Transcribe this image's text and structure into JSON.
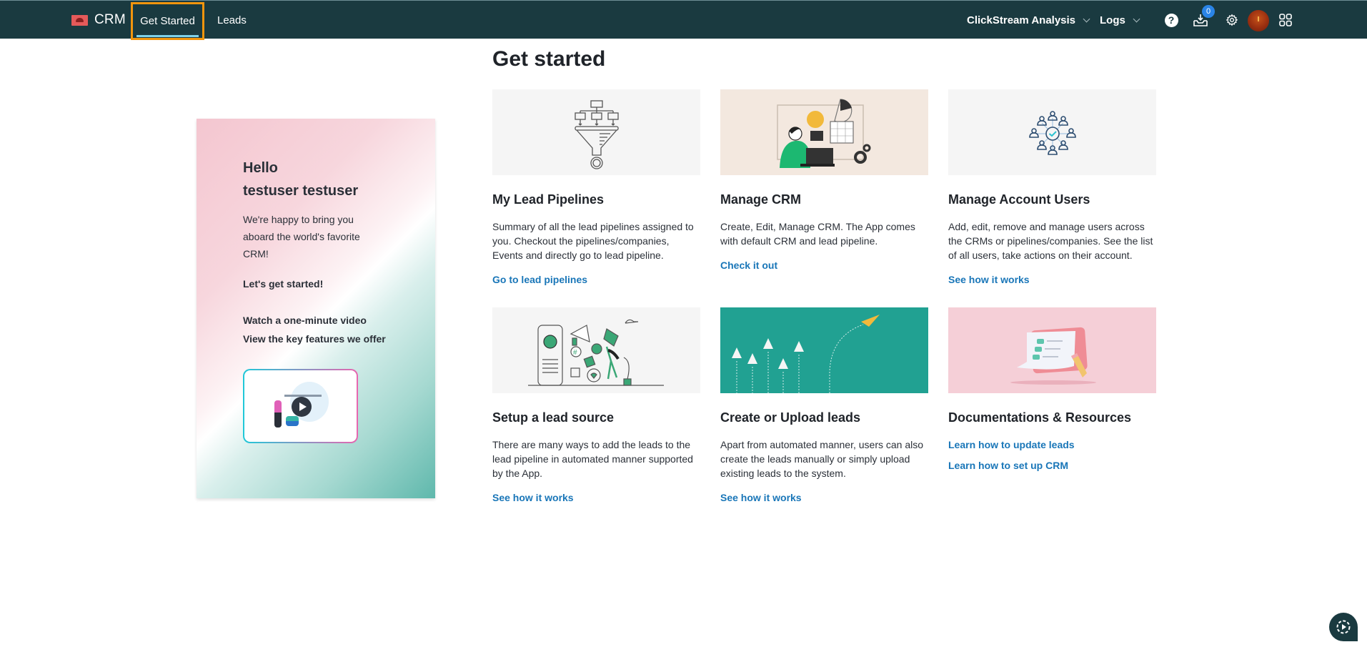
{
  "navbar": {
    "brand": "CRM",
    "tabs": [
      {
        "label": "Get Started",
        "active": true
      },
      {
        "label": "Leads",
        "active": false
      }
    ],
    "dropdowns": [
      {
        "label": "ClickStream Analysis"
      },
      {
        "label": "Logs"
      }
    ],
    "icons": [
      "help-icon",
      "inbox-download-icon",
      "gear-icon",
      "avatar",
      "apps-grid-icon"
    ],
    "inbox_badge": "0",
    "colors": {
      "navbar_bg": "#1a3a40",
      "active_highlight": "#f2950d",
      "badge": "#2a84e6"
    }
  },
  "hero": {
    "greeting": "Hello",
    "user_name": "testuser testuser",
    "intro": "We're happy to bring you aboard the world's favorite CRM!",
    "cta": "Let's get started!",
    "links": [
      "Watch a one-minute video",
      "View the key features we offer"
    ],
    "video_icon": "play-icon"
  },
  "main": {
    "title": "Get started",
    "link_color": "#1976b8",
    "cards": [
      {
        "title": "My Lead Pipelines",
        "description": "Summary of all the lead pipelines assigned to you. Checkout the pipelines/companies, Events and directly go to lead pipeline.",
        "links": [
          "Go to lead pipelines"
        ],
        "image": "funnel-illustration"
      },
      {
        "title": "Manage CRM",
        "description": "Create, Edit, Manage CRM. The App comes with default CRM and lead pipeline.",
        "links": [
          "Check it out"
        ],
        "image": "person-at-laptop-illustration"
      },
      {
        "title": "Manage Account Users",
        "description": "Add, edit, remove and manage users across the CRMs or pipelines/companies. See the list of all users, take actions on their account.",
        "links": [
          "See how it works"
        ],
        "image": "users-network-illustration"
      },
      {
        "title": "Setup a lead source",
        "description": "There are many ways to add the leads to the lead pipeline in automated manner supported by the App.",
        "links": [
          "See how it works"
        ],
        "image": "social-media-illustration"
      },
      {
        "title": "Create or Upload leads",
        "description": "Apart from automated manner, users can also create the leads manually or simply upload existing leads to the system.",
        "links": [
          "See how it works"
        ],
        "image": "paper-planes-illustration"
      },
      {
        "title": "Documentations & Resources",
        "description": "",
        "links": [
          "Learn how to update leads",
          "Learn how to set up CRM"
        ],
        "image": "checklist-illustration"
      }
    ]
  },
  "floating_button": {
    "icon": "guided-tour-play-icon"
  }
}
